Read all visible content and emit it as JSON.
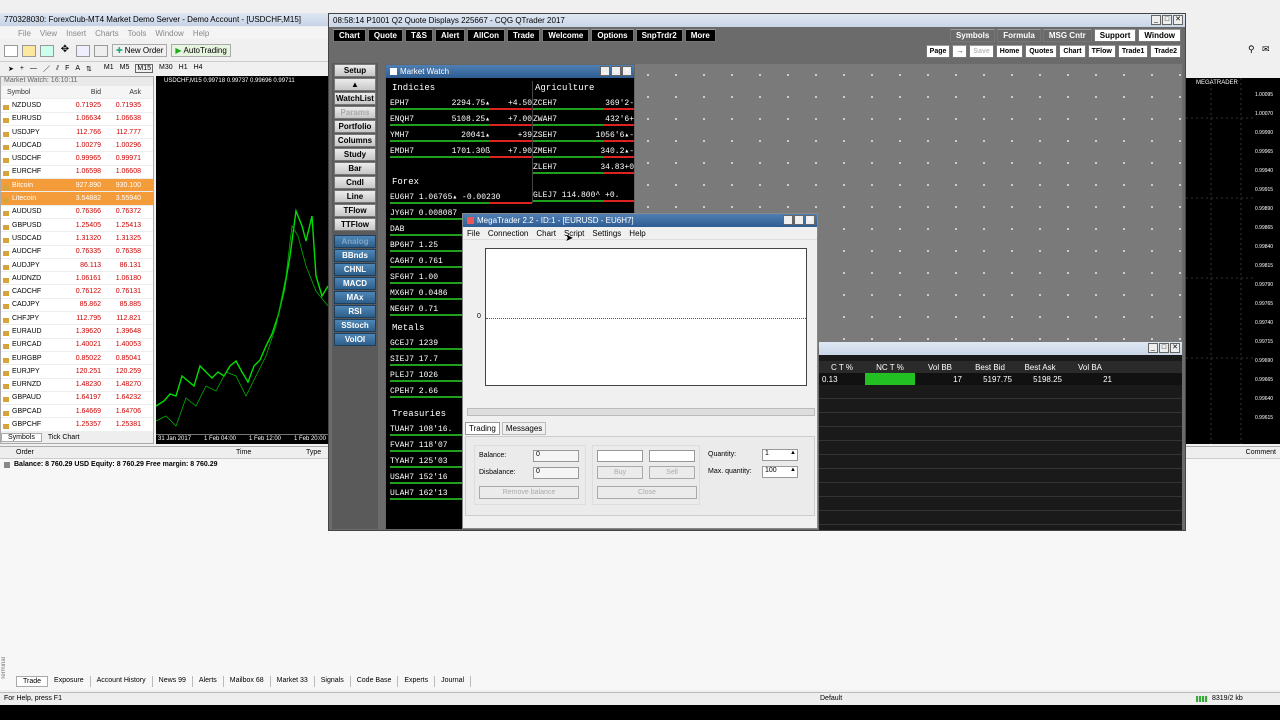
{
  "mt4": {
    "title": "770328030: ForexClub-MT4 Market Demo Server - Demo Account - [USDCHF,M15]",
    "menu": [
      "File",
      "View",
      "Insert",
      "Charts",
      "Tools",
      "Window",
      "Help"
    ],
    "new_order": "New Order",
    "autotrading": "AutoTrading",
    "tf": [
      "M1",
      "M5",
      "M15",
      "M30",
      "H1",
      "H4"
    ],
    "mw_title": "Market Watch: 16:10:11",
    "mw_headers": [
      "Symbol",
      "Bid",
      "Ask"
    ],
    "mw_rows": [
      [
        "NZDUSD",
        "0.71925",
        "0.71935"
      ],
      [
        "EURUSD",
        "1.06634",
        "1.06638"
      ],
      [
        "USDJPY",
        "112.766",
        "112.777"
      ],
      [
        "AUDCAD",
        "1.00279",
        "1.00296"
      ],
      [
        "USDCHF",
        "0.99965",
        "0.99971"
      ],
      [
        "EURCHF",
        "1.06598",
        "1.06608"
      ],
      [
        "Bitcoin",
        "927.890",
        "930.100"
      ],
      [
        "Litecoin",
        "3.54882",
        "3.55940"
      ],
      [
        "AUDUSD",
        "0.76366",
        "0.76372"
      ],
      [
        "GBPUSD",
        "1.25405",
        "1.25413"
      ],
      [
        "USDCAD",
        "1.31320",
        "1.31325"
      ],
      [
        "AUDCHF",
        "0.76335",
        "0.76358"
      ],
      [
        "AUDJPY",
        "86.113",
        "86.131"
      ],
      [
        "AUDNZD",
        "1.06161",
        "1.06180"
      ],
      [
        "CADCHF",
        "0.76122",
        "0.76131"
      ],
      [
        "CADJPY",
        "85.862",
        "85.885"
      ],
      [
        "CHFJPY",
        "112.795",
        "112.821"
      ],
      [
        "EURAUD",
        "1.39620",
        "1.39648"
      ],
      [
        "EURCAD",
        "1.40021",
        "1.40053"
      ],
      [
        "EURGBP",
        "0.85022",
        "0.85041"
      ],
      [
        "EURJPY",
        "120.251",
        "120.259"
      ],
      [
        "EURNZD",
        "1.48230",
        "1.48270"
      ],
      [
        "GBPAUD",
        "1.64197",
        "1.64232"
      ],
      [
        "GBPCAD",
        "1.64669",
        "1.64706"
      ],
      [
        "GBPCHF",
        "1.25357",
        "1.25381"
      ]
    ],
    "mw_tabs": [
      "Symbols",
      "Tick Chart"
    ],
    "chart_label": "USDCHF,M15  0.99718 0.99737 0.99696 0.99711",
    "dates": [
      "31 Jan 2017",
      "1 Feb 04:00",
      "1 Feb 12:00",
      "1 Feb 20:00"
    ],
    "term_headers": [
      "Order",
      "Time",
      "Type"
    ],
    "term_comment": "Comment",
    "balance_line": "Balance: 8 760.29 USD  Equity: 8 760.29  Free margin: 8 760.29",
    "bottom_tabs": [
      "Trade",
      "Exposure",
      "Account History",
      "News 99",
      "Alerts",
      "Mailbox 68",
      "Market 33",
      "Signals",
      "Code Base",
      "Experts",
      "Journal"
    ],
    "status_left": "For Help, press F1",
    "status_mid": "Default",
    "status_right": "8319/2 kb",
    "terminal_label": "Terminal",
    "right_chart_label": "MEGATRADER",
    "right_prices": [
      "1.00095",
      "1.00070",
      "0.99990",
      "0.99965",
      "0.99940",
      "0.99915",
      "0.99890",
      "0.99865",
      "0.99840",
      "0.99815",
      "0.99790",
      "0.99765",
      "0.99740",
      "0.99715",
      "0.99690",
      "0.99665",
      "0.99640",
      "0.99615"
    ]
  },
  "cqg": {
    "title": "08:58:14  P1001 Q2 Quote Displays  225667 - CQG QTrader 2017",
    "top_buttons": [
      "Chart",
      "Quote",
      "T&S",
      "Alert",
      "AllCon",
      "Trade",
      "Welcome",
      "Options",
      "SnpTrdr2",
      "More"
    ],
    "right_top": [
      "Symbols",
      "Formula",
      "MSG Cntr",
      "Support",
      "Window"
    ],
    "right_row2": [
      "Page",
      "→",
      "Save",
      "Home",
      "Quotes",
      "Chart",
      "TFlow",
      "Trade1",
      "Trade2"
    ],
    "side_buttons": [
      "Setup",
      "▲",
      "WatchList",
      "Params",
      "Portfolio",
      "Columns",
      "Study",
      "Bar",
      "Cndl",
      "Line",
      "TFlow",
      "TTFlow"
    ],
    "side_blue": [
      "Analog",
      "BBnds",
      "CHNL",
      "MACD",
      "MAx",
      "RSI",
      "SStoch",
      "VolOI"
    ],
    "mw_title": "Market Watch",
    "indices_title": "Indicies",
    "indices": [
      [
        "EPH7",
        "2294.75▴",
        "+4.50"
      ],
      [
        "ENQH7",
        "5108.25▴",
        "+7.00"
      ],
      [
        "YMH7",
        "20041▴",
        "+39"
      ],
      [
        "EMDH7",
        "1701.30ß",
        "+7.90"
      ]
    ],
    "agri_title": "Agriculture",
    "agri": [
      [
        "ZCEH7",
        "369'2",
        "-"
      ],
      [
        "ZWAH7",
        "432'6",
        "+"
      ],
      [
        "ZSEH7",
        "1056'6▴",
        "-"
      ],
      [
        "ZMEH7",
        "340.2▴",
        "-"
      ],
      [
        "ZLEH7",
        "34.83",
        "+0"
      ]
    ],
    "forex_title": "Forex",
    "forex": [
      "EU6H7  1.06765▴ -0.00230",
      "JY6H7 0.008087",
      "DAB",
      "BP6H7   1.25",
      "CA6H7   0.761",
      "SF6H7   1.00",
      "MX6H7  0.0486",
      "NE6H7   0.71"
    ],
    "gle": "GLEJ7 114.800^ +0.",
    "metals_title": "Metals",
    "metals": [
      "GCEJ7    1239",
      "SIEJ7    17.7",
      "PLEJ7    1026",
      "CPEH7    2.66"
    ],
    "treas_title": "Treasuries",
    "treas": [
      "TUAH7 108'16.",
      "FVAH7 118'07",
      "TYAH7  125'03",
      "USAH7  152'16",
      "ULAH7  162'13"
    ],
    "grid_headers": [
      "C T %",
      "NC T %",
      "Vol BB",
      "Best Bid",
      "Best Ask",
      "Vol BA"
    ],
    "grid_row": [
      "0.13",
      "",
      "17",
      "5197.75",
      "5198.25",
      "21"
    ]
  },
  "mega": {
    "title": "MegaTrader 2.2 - ID:1 - [EURUSD - EU6H7]",
    "menu": [
      "File",
      "Connection",
      "Chart",
      "Script",
      "Settings",
      "Help"
    ],
    "zero": "0",
    "tabs": [
      "Trading",
      "Messages"
    ],
    "balance_label": "Balance:",
    "balance_val": "0",
    "disb_label": "Disbalance:",
    "disb_val": "0",
    "remove_btn": "Remove balance",
    "buy": "Buy",
    "sell": "Sell",
    "close": "Close",
    "qty_label": "Quantity:",
    "qty_val": "1",
    "maxq_label": "Max. quantity:",
    "maxq_val": "100"
  },
  "colors": {
    "bg_dark": "#000000",
    "accent_orange": "#f49b3a",
    "cqg_blue": "#2e5f8b",
    "bull": "#1ea01e",
    "bear": "#dd2222"
  }
}
